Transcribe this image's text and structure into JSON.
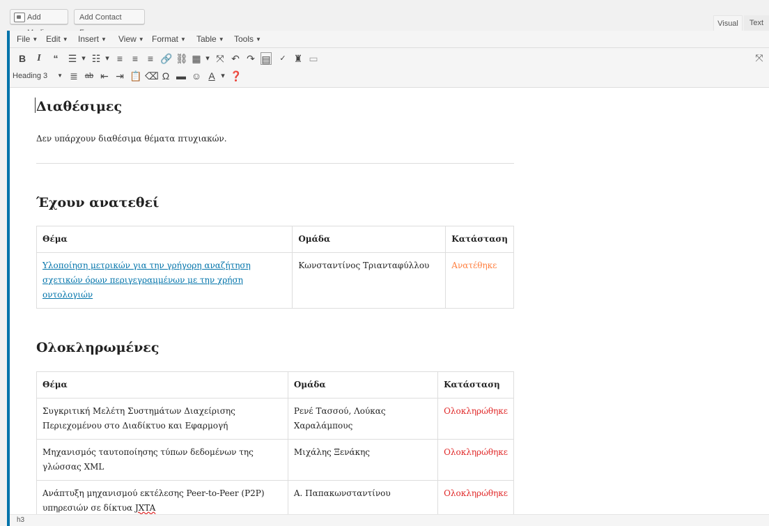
{
  "media_buttons": {
    "add_media": "Add Media",
    "add_contact_form": "Add Contact Form"
  },
  "editor_tabs": {
    "visual": "Visual",
    "text": "Text"
  },
  "menubar": [
    {
      "label": "File"
    },
    {
      "label": "Edit"
    },
    {
      "label": "Insert"
    },
    {
      "label": "View"
    },
    {
      "label": "Format"
    },
    {
      "label": "Table"
    },
    {
      "label": "Tools"
    }
  ],
  "toolbar": {
    "format_select": "Heading 3",
    "row1_icons": [
      "bold-icon",
      "italic-icon",
      "blockquote-icon",
      "bullet-list-icon",
      "numbered-list-icon",
      "align-left-icon",
      "align-center-icon",
      "align-right-icon",
      "link-icon",
      "unlink-icon",
      "table-icon",
      "fullscreen-icon",
      "undo-icon",
      "redo-icon",
      "keyboard-icon",
      "spellcheck-icon",
      "stamp-icon",
      "media-icon"
    ],
    "row2_icons": [
      "justify-icon",
      "strikethrough-icon",
      "outdent-icon",
      "indent-icon",
      "paste-text-icon",
      "clear-format-icon",
      "omega-icon",
      "horizontal-rule-icon",
      "emoji-icon",
      "text-color-icon",
      "help-icon"
    ]
  },
  "content": {
    "available": {
      "heading": "Διαθέσιμες",
      "text": "Δεν υπάρχουν διαθέσιμα θέματα πτυχιακών."
    },
    "assigned": {
      "heading": "Έχουν ανατεθεί",
      "columns": [
        "Θέμα",
        "Ομάδα",
        "Κατάσταση"
      ],
      "rows": [
        {
          "topic": "Υλοποίηση μετρικών για την γρήγορη αναζήτηση σχετικών όρων περιγεγραμμένων με την χρήση οντολογιών",
          "group": "Κωνσταντίνος Τριανταφύλλου",
          "status": "Ανατέθηκε"
        }
      ]
    },
    "completed": {
      "heading": "Ολοκληρωμένες",
      "columns": [
        "Θέμα",
        "Ομάδα",
        "Κατάσταση"
      ],
      "rows": [
        {
          "topic": "Συγκριτική Μελέτη Συστημάτων Διαχείρισης Περιεχομένου στο Διαδίκτυο και Εφαρμογή",
          "group": "Ρενέ Τασσού, Λούκας Χαραλάμπους",
          "status": "Ολοκληρώθηκε"
        },
        {
          "topic": "Μηχανισμός ταυτοποίησης τύπων δεδομένων της γλώσσας XML",
          "group": "Μιχάλης Ξενάκης",
          "status": "Ολοκληρώθηκε"
        },
        {
          "topic_prefix": "Ανάπτυξη μηχανισμού εκτέλεσης Peer-to-Peer (P2P) υπηρεσιών σε δίκτυα ",
          "topic_flagged": "JXTA",
          "group": "Α. Παπακωνσταντίνου",
          "status": "Ολοκληρώθηκε"
        }
      ]
    }
  },
  "statusbar": {
    "path": "h3"
  },
  "colors": {
    "accent": "#0073aa",
    "assigned": "#ff7f3f",
    "completed": "#e02828"
  }
}
